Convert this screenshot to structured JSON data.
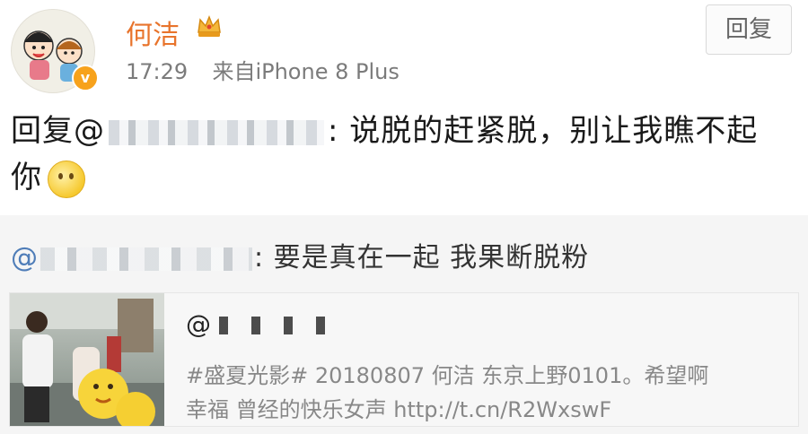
{
  "header": {
    "username": "何洁",
    "time": "17:29",
    "source": "来自iPhone 8 Plus",
    "reply_button": "回复",
    "verified_badge": "v"
  },
  "comment": {
    "prefix": "回复@",
    "suffix": ": 说脱的赶紧脱，别让我瞧不起",
    "line2": "你"
  },
  "quoted": {
    "at": "@",
    "text": ": 要是真在一起 我果断脱粉",
    "card": {
      "at": "@",
      "line1": "#盛夏光影# 20180807  何洁 东京上野0101。希望啊",
      "line2": "幸福 曾经的快乐女声 http://t.cn/R2WxswF"
    }
  }
}
